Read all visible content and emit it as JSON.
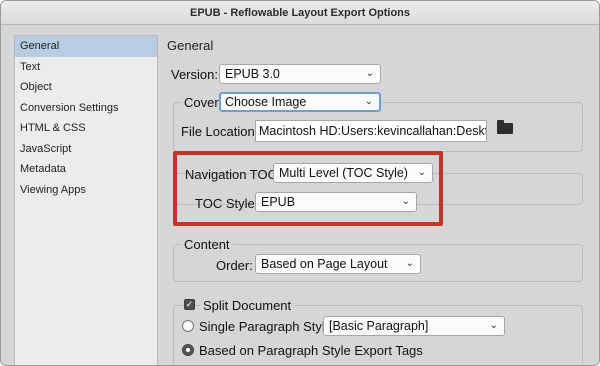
{
  "window": {
    "title": "EPUB - Reflowable Layout Export Options"
  },
  "sidebar": {
    "items": [
      {
        "label": "General"
      },
      {
        "label": "Text"
      },
      {
        "label": "Object"
      },
      {
        "label": "Conversion Settings"
      },
      {
        "label": "HTML & CSS"
      },
      {
        "label": "JavaScript"
      },
      {
        "label": "Metadata"
      },
      {
        "label": "Viewing Apps"
      }
    ],
    "selected": "General"
  },
  "main": {
    "section_title": "General",
    "version": {
      "label": "Version:",
      "value": "EPUB 3.0"
    },
    "cover": {
      "label": "Cover",
      "value": "Choose Image"
    },
    "file_location": {
      "label": "File Location:",
      "value": "Macintosh HD:Users:kevincallahan:Desktc"
    },
    "navigation_toc": {
      "label": "Navigation TOC",
      "value": "Multi Level (TOC Style)"
    },
    "toc_style": {
      "label": "TOC Style:",
      "value": "EPUB"
    },
    "content": {
      "label": "Content",
      "order_label": "Order:",
      "order_value": "Based on Page Layout"
    },
    "split_document": {
      "label": "Split Document",
      "checked": true,
      "single_paragraph_style": {
        "label": "Single Paragraph Style",
        "value": "[Basic Paragraph]",
        "selected": false
      },
      "based_on_tags": {
        "label": "Based on Paragraph Style Export Tags",
        "selected": true
      }
    }
  },
  "colors": {
    "highlight": "#c8312b",
    "selection": "#b8cde2",
    "focus": "#6c9fd6"
  }
}
